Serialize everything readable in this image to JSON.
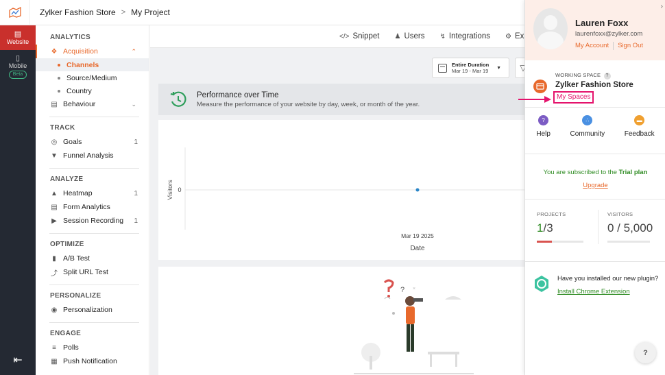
{
  "header": {
    "crumbs": [
      "Zylker Fashion Store",
      "My Project"
    ]
  },
  "rail": {
    "items": [
      {
        "label": "Website",
        "icon": "website-icon"
      },
      {
        "label": "Mobile",
        "icon": "mobile-icon",
        "badge": "Beta"
      }
    ],
    "collapse_icon": "collapse-icon"
  },
  "nav": {
    "analytics": "ANALYTICS",
    "acquisition": "Acquisition",
    "channels": "Channels",
    "source_medium": "Source/Medium",
    "country": "Country",
    "behaviour": "Behaviour",
    "track": "TRACK",
    "goals": "Goals",
    "goals_count": "1",
    "funnel": "Funnel Analysis",
    "analyze": "ANALYZE",
    "heatmap": "Heatmap",
    "heatmap_count": "1",
    "form_analytics": "Form Analytics",
    "session_recording": "Session Recording",
    "session_count": "1",
    "optimize": "OPTIMIZE",
    "ab_test": "A/B Test",
    "split_url": "Split URL Test",
    "personalize": "PERSONALIZE",
    "personalization": "Personalization",
    "engage": "ENGAGE",
    "polls": "Polls",
    "push": "Push Notification"
  },
  "tabs": {
    "snippet": "Snippet",
    "users": "Users",
    "integrations": "Integrations",
    "exp": "Exp"
  },
  "date_filter": {
    "title": "Entire Duration",
    "range": "Mar 19 - Mar 19"
  },
  "perf": {
    "title": "Performance over Time",
    "subtitle": "Measure the performance of your website by day, week, or month of the year."
  },
  "chart_data": {
    "type": "line",
    "x": [
      "Mar 19 2025"
    ],
    "series": [
      {
        "values": [
          0
        ]
      }
    ],
    "xlabel": "Date",
    "ylabel": "Visitors",
    "yticks": [
      "0"
    ]
  },
  "panel": {
    "name": "Lauren Foxx",
    "email": "laurenfoxx@zylker.com",
    "my_account": "My Account",
    "sign_out": "Sign Out",
    "working_space_label": "WORKING SPACE",
    "working_space_help": "?",
    "working_space_name": "Zylker Fashion Store",
    "my_spaces": "My Spaces",
    "help": "Help",
    "community": "Community",
    "feedback": "Feedback",
    "trial_prefix": "You are subscribed to the ",
    "trial_plan": "Trial plan",
    "upgrade": "Upgrade",
    "projects_label": "PROJECTS",
    "projects_used": "1",
    "projects_total": "/3",
    "projects_fraction": 0.33,
    "visitors_label": "VISITORS",
    "visitors_value": "0 / 5,000",
    "visitors_fraction": 0,
    "plugin_question": "Have you installed our new plugin?",
    "plugin_link": "Install Chrome Extension",
    "help_fab": "?"
  },
  "colors": {
    "accent": "#e8692c",
    "rail_active": "#c9302c",
    "green": "#2e8b22",
    "highlight": "#e4136c"
  }
}
